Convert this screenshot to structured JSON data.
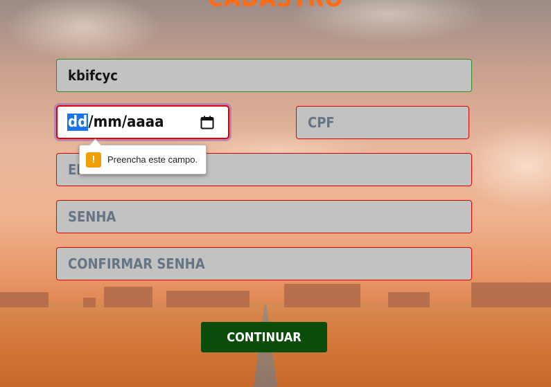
{
  "form": {
    "title": "CADASTRO",
    "name_value": "kbifcyc",
    "date": {
      "day": "dd",
      "rest": "/mm/aaaa"
    },
    "cpf_placeholder": "CPF",
    "email_placeholder": "EMAIL",
    "senha_placeholder": "SENHA",
    "confirmar_placeholder": "CONFIRMAR SENHA",
    "submit_label": "CONTINUAR"
  },
  "validation": {
    "message": "Preencha este campo.",
    "icon": "warning-icon"
  },
  "colors": {
    "title": "#ff6a13",
    "button": "#0a4d0a",
    "field_bg": "#c2c2c2",
    "invalid_border": "#e00000",
    "valid_border": "#2e8b2e",
    "tooltip_icon": "#f29f05"
  }
}
